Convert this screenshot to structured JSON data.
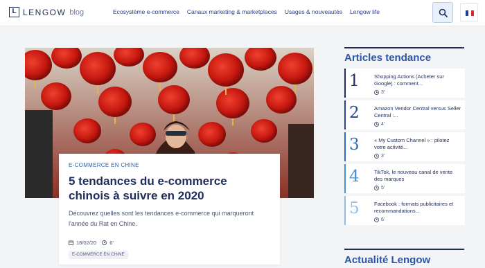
{
  "header": {
    "logo_word": "LENGOW",
    "logo_blog": "blog",
    "nav": [
      "Ecosystème e-commerce",
      "Canaux marketing & marketplaces",
      "Usages & nouveautés",
      "Lengow life"
    ]
  },
  "colors": {
    "brand": "#1f2d5a",
    "accent": "#2c56a6",
    "flag": [
      "#1c3f94",
      "#ffffff",
      "#e1242b"
    ]
  },
  "hero": {
    "image_subject": "red paper lanterns with woman looking up",
    "category": "E-COMMERCE EN CHINE",
    "title": "5 tendances du e-commerce chinois à suivre en 2020",
    "description": "Découvrez quelles sont les tendances e-commerce qui marqueront l'année du Rat en Chine.",
    "date": "18/02/20",
    "read_time": "6'",
    "tag": "E-COMMERCE EN CHINE"
  },
  "sidebar": {
    "trending_title": "Articles tendance",
    "items": [
      {
        "num": "1",
        "title": "Shopping Actions (Acheter sur Google) : comment...",
        "time": "3'",
        "color": "#1f2d5a"
      },
      {
        "num": "2",
        "title": "Amazon Vendor Central versus Seller Central :...",
        "time": "4'",
        "color": "#23458e"
      },
      {
        "num": "3",
        "title": "« My Custom Channel » : pilotez votre activité...",
        "time": "3'",
        "color": "#2e6cb8"
      },
      {
        "num": "4",
        "title": "TikTok, le nouveau canal de vente des marques",
        "time": "5'",
        "color": "#4a8fd0"
      },
      {
        "num": "5",
        "title": "Facebook : formats publicitaires et recommandations...",
        "time": "6'",
        "color": "#8fbde6"
      }
    ],
    "news_title": "Actualité Lengow"
  }
}
